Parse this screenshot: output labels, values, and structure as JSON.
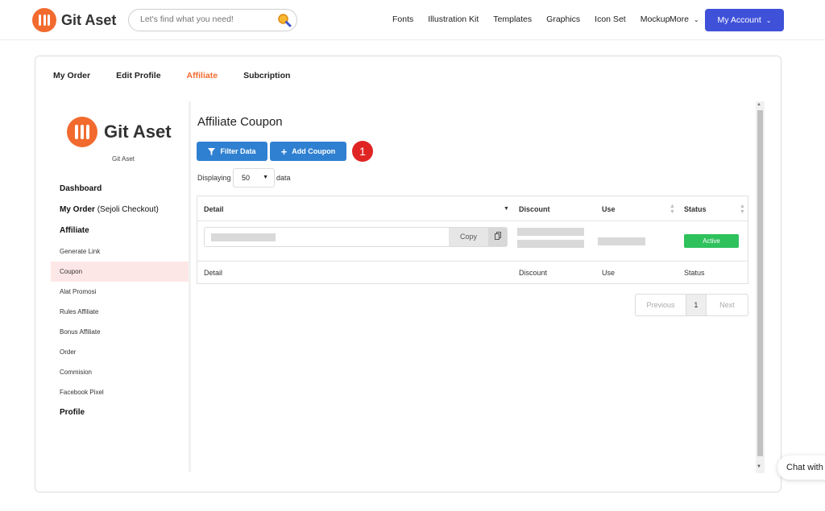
{
  "brand": {
    "name": "Git Aset",
    "accent": "#f26a2e"
  },
  "search": {
    "placeholder": "Let's find what you need!"
  },
  "nav": {
    "links": [
      "Fonts",
      "Illustration Kit",
      "Templates",
      "Graphics",
      "Icon Set",
      "Mockup"
    ],
    "more": "More",
    "account": "My Account",
    "account_color": "#3f51d9"
  },
  "tabs": [
    {
      "label": "My Order",
      "active": false
    },
    {
      "label": "Edit Profile",
      "active": false
    },
    {
      "label": "Affiliate",
      "active": true
    },
    {
      "label": "Subcription",
      "active": false
    }
  ],
  "sidebar": {
    "brand": "Git Aset",
    "subtitle": "Git Aset",
    "dashboard": "Dashboard",
    "my_order": "My Order",
    "my_order_suffix": "(Sejoli Checkout)",
    "affiliate": "Affiliate",
    "items": [
      "Generate Link",
      "Coupon",
      "Alat Promosi",
      "Rules Affiliate",
      "Bonus Affiliate",
      "Order",
      "Commision",
      "Facebook Pixel"
    ],
    "active_item": "Coupon",
    "profile": "Profile"
  },
  "main": {
    "title": "Affiliate Coupon",
    "filter_button": "Filter Data",
    "add_button": "Add Coupon",
    "step_badge": "1",
    "displaying_label": "Displaying",
    "per_page": "50",
    "data_label": "data",
    "table": {
      "columns": [
        "Detail",
        "Discount",
        "Use",
        "Status"
      ],
      "footer": [
        "Detail",
        "Discount",
        "Use",
        "Status"
      ],
      "row": {
        "copy_label": "Copy",
        "status": "Active",
        "status_color": "#2fc15c"
      }
    },
    "pager": {
      "prev": "Previous",
      "page": "1",
      "next": "Next"
    }
  },
  "chat": {
    "label": "Chat with"
  }
}
